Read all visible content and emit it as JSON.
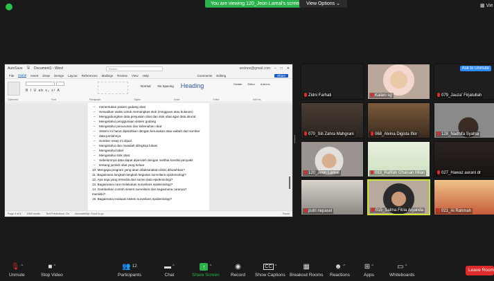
{
  "top": {
    "sharing_banner": "You are viewing 120_Jeon Lareal's screen",
    "view_options": "View Options",
    "right_label": "Vie"
  },
  "word": {
    "autosave": "AutoSave",
    "doc_title": "Document1 - Word",
    "search_placeholder": "Search",
    "account": "andrew@gmail.com",
    "menu": [
      "File",
      "Home",
      "Insert",
      "Draw",
      "Design",
      "Layout",
      "References",
      "Mailings",
      "Review",
      "View",
      "Help"
    ],
    "active_menu": "Home",
    "comments": "Comments",
    "editing": "Editing",
    "share": "Share",
    "style_normal": "Normal",
    "style_nospacing": "No Spacing",
    "style_heading": "Heading",
    "tools": [
      "Dictate",
      "Editor",
      "Add-ins"
    ],
    "group_labels": [
      "Clipboard",
      "Font",
      "Paragraph",
      "Styles",
      "Voice",
      "Editor",
      "Add-ins"
    ],
    "doc_lines": [
      {
        "t": "menentukan pasien gudang obat",
        "k": "b"
      },
      {
        "t": "Sesuaikan waktu untuk memangkas stok (mingguan atau bulanan)",
        "k": "b"
      },
      {
        "t": "Menggabungkan data penjualan obat dan stok obat agar data akurat",
        "k": "b"
      },
      {
        "t": "Mengetahui penggunaan sistem gudang",
        "k": "b"
      },
      {
        "t": "Mengetahui penurunan dan kelemahan obat",
        "k": "b"
      },
      {
        "t": "Sistem ini harus dipisahkan dengan kerusakan atau wabah dari sumber",
        "k": "b"
      },
      {
        "t": "data jumlahnya",
        "k": "b"
      },
      {
        "t": "Sumber resep ini dijual",
        "k": "b"
      },
      {
        "t": "Mengetahui dan masalah dilingkup lokasi",
        "k": "b"
      },
      {
        "t": "Mengetahui label",
        "k": "b"
      },
      {
        "t": "Mengetahui stok obat",
        "k": "b"
      },
      {
        "t": "Sebelumnya data dapat diperoleh dengan melihat kondisi penyakit",
        "k": "b"
      },
      {
        "t": "tentang jumlah obat yang keluar",
        "k": "b"
      },
      {
        "t": "10. Mengapa program yang akan dilaksanakan disini dibutuhkan?",
        "k": "n"
      },
      {
        "t": "11. Bagaimana langkah-langkah kegiatan surveilans epidemiologi?",
        "k": "n"
      },
      {
        "t": "12. Apa saja yang tersedia dari survei data epidemiologi?",
        "k": "n"
      },
      {
        "t": "13. Bagaimana cara melakukan surveilans epidemiologi?",
        "k": "n"
      },
      {
        "t": "14. Gambarkan contoh sistem surveilans dan bagaimana caranya?",
        "k": "n"
      },
      {
        "t": "memiliki?",
        "k": "n"
      },
      {
        "t": "15. Bagaimana evaluasi sistem surveilans epidemiologi?",
        "k": "n"
      }
    ],
    "status_left": [
      "Page 4 of 5",
      "1963 words",
      "Text Predictions: On",
      "Accessibility: Good to go"
    ],
    "status_right": "Focus"
  },
  "participants": [
    {
      "name": "Zidni Farhati",
      "photo": "dark"
    },
    {
      "name": "Kalani sg",
      "photo": "person-hijab"
    },
    {
      "name": "079_Jauza' Firjatullah",
      "photo": "dark",
      "badge": "Ask to Unmute"
    },
    {
      "name": "070_Siti Zahra Mahgrani",
      "photo": "room"
    },
    {
      "name": "068_Alvina Digista Ifior",
      "photo": "room-warm"
    },
    {
      "name": "128_Nadhifa Syahla",
      "photo": "person"
    },
    {
      "name": "120_Jeon Lareal",
      "photo": "person-glasses"
    },
    {
      "name": "063_Rafifah Ghaisan Milan",
      "photo": "floral"
    },
    {
      "name": "027_Hawaz aurani dr",
      "photo": "dark-room"
    },
    {
      "name": "putri nepasel",
      "photo": "room-light"
    },
    {
      "name": "015_Salma Fitria Aryanda",
      "photo": "person-active",
      "active": true
    },
    {
      "name": "021_Ai Rahmah",
      "photo": "bridge"
    }
  ],
  "toolbar": {
    "unmute": "Unmute",
    "stop_video": "Stop Video",
    "participants": "Participants",
    "participants_count": "12",
    "chat": "Chat",
    "share_screen": "Share Screen",
    "record": "Record",
    "show_captions": "Show Captions",
    "breakout_rooms": "Breakout Rooms",
    "reactions": "Reactions",
    "apps": "Apps",
    "whiteboards": "Whiteboards",
    "leave": "Leave Room"
  },
  "colors": {
    "share_green": "#2bb24c",
    "leave_red": "#e02b2b",
    "word_blue": "#185abd",
    "active_border": "#cde23a"
  }
}
